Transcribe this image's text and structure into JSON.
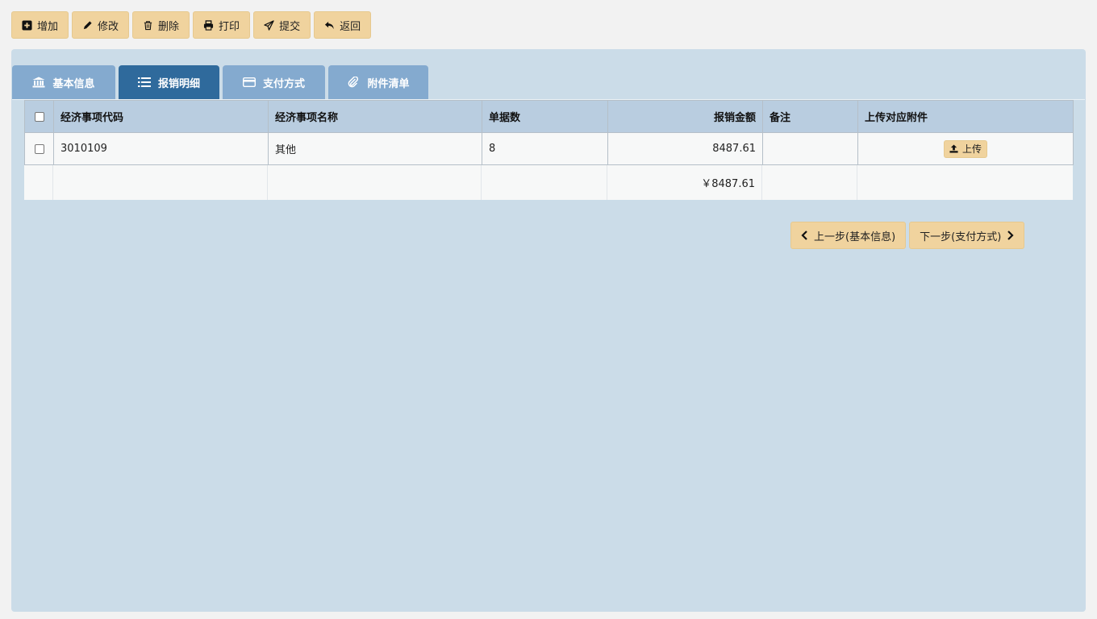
{
  "toolbar": {
    "add": "增加",
    "edit": "修改",
    "delete": "删除",
    "print": "打印",
    "submit": "提交",
    "back": "返回"
  },
  "tabs": [
    {
      "label": "基本信息",
      "icon": "bank-icon"
    },
    {
      "label": "报销明细",
      "icon": "list-icon",
      "active": true
    },
    {
      "label": "支付方式",
      "icon": "credit-card-icon"
    },
    {
      "label": "附件清单",
      "icon": "paperclip-icon"
    }
  ],
  "table": {
    "headers": [
      "经济事项代码",
      "经济事项名称",
      "单据数",
      "报销金额",
      "备注",
      "上传对应附件"
    ],
    "rows": [
      {
        "code": "3010109",
        "name": "其他",
        "count": "8",
        "amount": "8487.61",
        "remark": "",
        "upload_label": "上传"
      }
    ],
    "total": "￥8487.61"
  },
  "nav": {
    "prev": "上一步(基本信息)",
    "next": "下一步(支付方式)"
  },
  "colors": {
    "button_bg": "#f0d39e",
    "panel_bg": "#cbdce8",
    "tab_bg": "#84aacf",
    "tab_active_bg": "#2f6a9c",
    "header_bg": "#b9cde0"
  }
}
